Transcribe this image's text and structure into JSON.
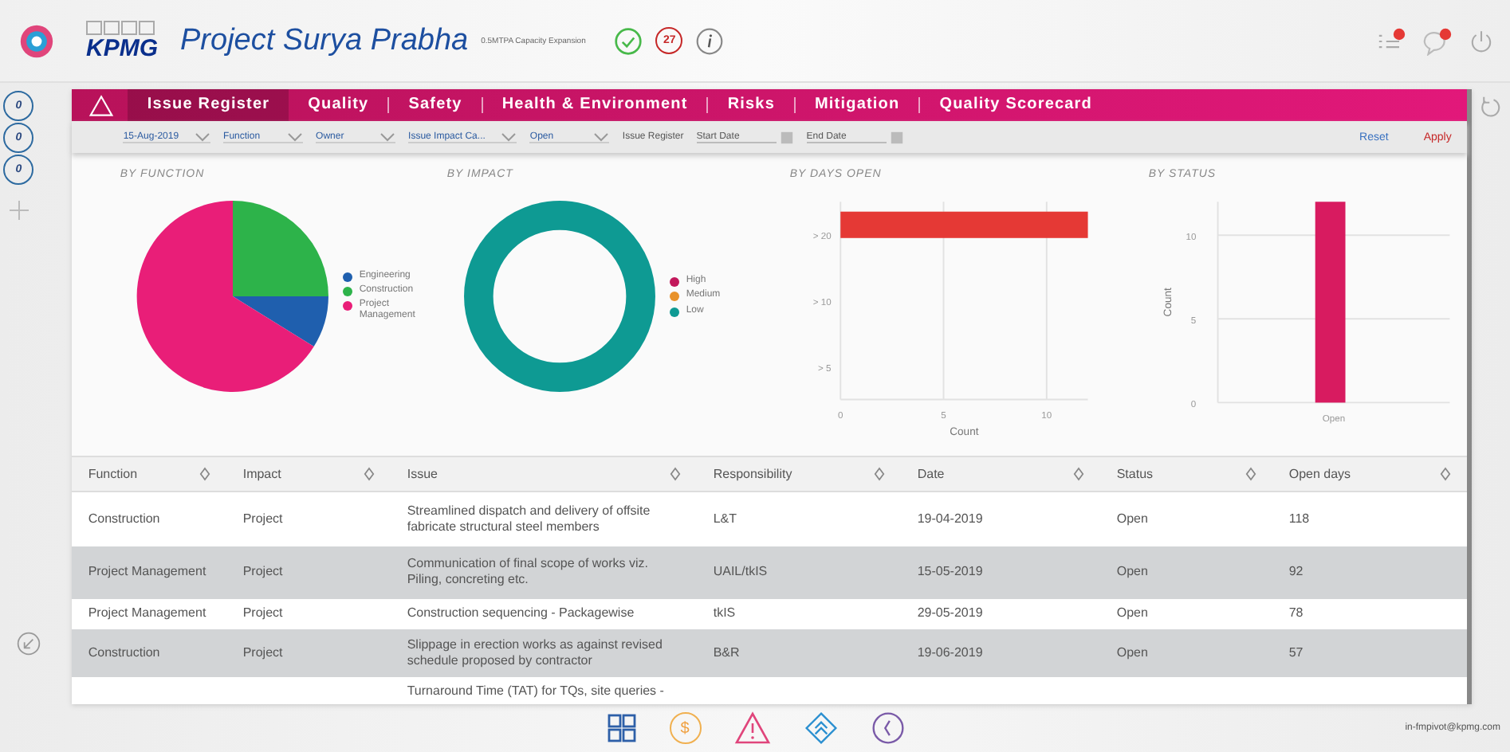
{
  "header": {
    "logo": "KPMG",
    "title": "Project Surya Prabha",
    "subtitle": "0.5MTPA Capacity Expansion",
    "count_badge": "27"
  },
  "rail": {
    "counters": [
      "0",
      "0",
      "0"
    ]
  },
  "nav": {
    "tabs": [
      {
        "label": "Issue Register",
        "selected": true
      },
      {
        "label": "Quality",
        "selected": false
      },
      {
        "label": "Safety",
        "selected": false
      },
      {
        "label": "Health & Environment",
        "selected": false
      },
      {
        "label": "Risks",
        "selected": false
      },
      {
        "label": "Mitigation",
        "selected": false
      },
      {
        "label": "Quality Scorecard",
        "selected": false
      }
    ]
  },
  "filters": {
    "dropdowns": [
      "15-Aug-2019",
      "Function",
      "Owner",
      "Issue Impact Ca...",
      "Open"
    ],
    "label": "Issue Register",
    "start_date": {
      "placeholder": "Start Date"
    },
    "end_date": {
      "placeholder": "End Date"
    },
    "reset": "Reset",
    "apply": "Apply"
  },
  "charts": {
    "by_function": {
      "title": "BY FUNCTION",
      "legend": [
        {
          "label": "Engineering",
          "color": "#1f5fae"
        },
        {
          "label": "Construction",
          "color": "#2db34a"
        },
        {
          "label": "Project Management",
          "color": "#e91e78"
        }
      ]
    },
    "by_impact": {
      "title": "BY IMPACT",
      "legend": [
        {
          "label": "High",
          "color": "#c2185b"
        },
        {
          "label": "Medium",
          "color": "#e8922a"
        },
        {
          "label": "Low",
          "color": "#0e9a93"
        }
      ]
    },
    "by_days_open": {
      "chart_data": {
        "type": "bar",
        "title": "BY DAYS OPEN",
        "orientation": "horizontal",
        "categories": [
          "> 20",
          "> 10",
          "> 5"
        ],
        "series": [
          {
            "color": "#e53935",
            "values": [
              12,
              0,
              0
            ]
          }
        ],
        "xlabel": "Count",
        "xlim": [
          0,
          12
        ],
        "xticks": [
          0,
          5,
          10
        ]
      }
    },
    "by_status": {
      "chart_data": {
        "type": "bar",
        "title": "BY STATUS",
        "categories": [
          "Open"
        ],
        "series": [
          {
            "color": "#d81b60",
            "values": [
              12
            ]
          }
        ],
        "ylabel": "Count",
        "ylim": [
          0,
          12
        ],
        "yticks": [
          0,
          5,
          10
        ]
      }
    }
  },
  "table": {
    "columns": [
      "Function",
      "Impact",
      "Issue",
      "Responsibility",
      "Date",
      "Status",
      "Open days"
    ],
    "rows": [
      {
        "cells": [
          "Construction",
          "Project",
          "Streamlined dispatch and delivery of offsite fabricate structural steel members",
          "L&T",
          "19-04-2019",
          "Open",
          "118"
        ]
      },
      {
        "cells": [
          "Project Management",
          "Project",
          "Communication of final scope of works viz. Piling, concreting etc.",
          "UAIL/tkIS",
          "15-05-2019",
          "Open",
          "92"
        ]
      },
      {
        "cells": [
          "Project Management",
          "Project",
          "Construction sequencing - Packagewise",
          "tkIS",
          "29-05-2019",
          "Open",
          "78"
        ]
      },
      {
        "cells": [
          "Construction",
          "Project",
          "Slippage in erection works as against revised schedule proposed by contractor",
          "B&R",
          "19-06-2019",
          "Open",
          "57"
        ]
      }
    ],
    "partial_row": {
      "issue": "Turnaround Time (TAT) for TQs, site queries -"
    }
  },
  "footer": {
    "coin_glyph": "$",
    "email": "in-fmpivot@kpmg.com"
  }
}
